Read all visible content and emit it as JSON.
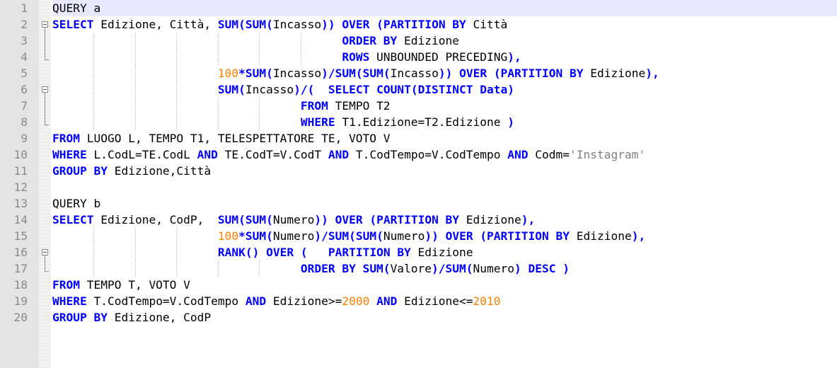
{
  "editor": {
    "line_numbers": [
      "1",
      "2",
      "3",
      "4",
      "5",
      "6",
      "7",
      "8",
      "9",
      "10",
      "11",
      "12",
      "13",
      "14",
      "15",
      "16",
      "17",
      "18",
      "19",
      "20"
    ],
    "lines": [
      [
        {
          "t": "QUERY a",
          "c": "pl"
        }
      ],
      [
        {
          "t": "SELECT",
          "c": "kw"
        },
        {
          "t": " Edizione, Città, ",
          "c": "pl"
        },
        {
          "t": "SUM(SUM(",
          "c": "kw"
        },
        {
          "t": "Incasso",
          "c": "pl"
        },
        {
          "t": "))",
          "c": "kw"
        },
        {
          "t": " ",
          "c": "pl"
        },
        {
          "t": "OVER",
          "c": "kw"
        },
        {
          "t": " ",
          "c": "pl"
        },
        {
          "t": "(PARTITION BY",
          "c": "kw"
        },
        {
          "t": " Città",
          "c": "pl"
        }
      ],
      [
        {
          "t": "                                          ",
          "c": "pl"
        },
        {
          "t": "ORDER BY",
          "c": "kw"
        },
        {
          "t": " Edizione",
          "c": "pl"
        }
      ],
      [
        {
          "t": "                                          ",
          "c": "pl"
        },
        {
          "t": "ROWS",
          "c": "kw"
        },
        {
          "t": " UNBOUNDED PRECEDING",
          "c": "pl"
        },
        {
          "t": "),",
          "c": "kw"
        }
      ],
      [
        {
          "t": "                        ",
          "c": "pl"
        },
        {
          "t": "100",
          "c": "num"
        },
        {
          "t": "*SUM(",
          "c": "kw"
        },
        {
          "t": "Incasso",
          "c": "pl"
        },
        {
          "t": ")/SUM(SUM(",
          "c": "kw"
        },
        {
          "t": "Incasso",
          "c": "pl"
        },
        {
          "t": "))",
          "c": "kw"
        },
        {
          "t": " ",
          "c": "pl"
        },
        {
          "t": "OVER",
          "c": "kw"
        },
        {
          "t": " ",
          "c": "pl"
        },
        {
          "t": "(PARTITION BY",
          "c": "kw"
        },
        {
          "t": " Edizione",
          "c": "pl"
        },
        {
          "t": "),",
          "c": "kw"
        }
      ],
      [
        {
          "t": "                        ",
          "c": "pl"
        },
        {
          "t": "SUM(",
          "c": "kw"
        },
        {
          "t": "Incasso",
          "c": "pl"
        },
        {
          "t": ")/(",
          "c": "kw"
        },
        {
          "t": "  ",
          "c": "pl"
        },
        {
          "t": "SELECT COUNT(DISTINCT",
          "c": "kw"
        },
        {
          "t": " ",
          "c": "pl"
        },
        {
          "t": "Data)",
          "c": "kw"
        }
      ],
      [
        {
          "t": "                                    ",
          "c": "pl"
        },
        {
          "t": "FROM",
          "c": "kw"
        },
        {
          "t": " TEMPO T2",
          "c": "pl"
        }
      ],
      [
        {
          "t": "                                    ",
          "c": "pl"
        },
        {
          "t": "WHERE",
          "c": "kw"
        },
        {
          "t": " T1.Edizione=T2.Edizione ",
          "c": "pl"
        },
        {
          "t": ")",
          "c": "kw"
        }
      ],
      [
        {
          "t": "FROM",
          "c": "kw"
        },
        {
          "t": " LUOGO L, TEMPO T1, TELESPETTATORE TE, VOTO V",
          "c": "pl"
        }
      ],
      [
        {
          "t": "WHERE",
          "c": "kw"
        },
        {
          "t": " L.CodL=TE.CodL ",
          "c": "pl"
        },
        {
          "t": "AND",
          "c": "kw"
        },
        {
          "t": " TE.CodT=V.CodT ",
          "c": "pl"
        },
        {
          "t": "AND",
          "c": "kw"
        },
        {
          "t": " T.CodTempo=V.CodTempo ",
          "c": "pl"
        },
        {
          "t": "AND",
          "c": "kw"
        },
        {
          "t": " Codm=",
          "c": "pl"
        },
        {
          "t": "'Instagram'",
          "c": "str"
        }
      ],
      [
        {
          "t": "GROUP BY",
          "c": "kw"
        },
        {
          "t": " Edizione,Città",
          "c": "pl"
        }
      ],
      [],
      [
        {
          "t": "QUERY b",
          "c": "pl"
        }
      ],
      [
        {
          "t": "SELECT",
          "c": "kw"
        },
        {
          "t": " Edizione, CodP,  ",
          "c": "pl"
        },
        {
          "t": "SUM(SUM(",
          "c": "kw"
        },
        {
          "t": "Numero",
          "c": "pl"
        },
        {
          "t": "))",
          "c": "kw"
        },
        {
          "t": " ",
          "c": "pl"
        },
        {
          "t": "OVER",
          "c": "kw"
        },
        {
          "t": " ",
          "c": "pl"
        },
        {
          "t": "(PARTITION BY",
          "c": "kw"
        },
        {
          "t": " Edizione",
          "c": "pl"
        },
        {
          "t": "),",
          "c": "kw"
        }
      ],
      [
        {
          "t": "                        ",
          "c": "pl"
        },
        {
          "t": "100",
          "c": "num"
        },
        {
          "t": "*SUM(",
          "c": "kw"
        },
        {
          "t": "Numero",
          "c": "pl"
        },
        {
          "t": ")/SUM(SUM(",
          "c": "kw"
        },
        {
          "t": "Numero",
          "c": "pl"
        },
        {
          "t": "))",
          "c": "kw"
        },
        {
          "t": " ",
          "c": "pl"
        },
        {
          "t": "OVER",
          "c": "kw"
        },
        {
          "t": " ",
          "c": "pl"
        },
        {
          "t": "(PARTITION BY",
          "c": "kw"
        },
        {
          "t": " Edizione",
          "c": "pl"
        },
        {
          "t": "),",
          "c": "kw"
        }
      ],
      [
        {
          "t": "                        ",
          "c": "pl"
        },
        {
          "t": "RANK() OVER (",
          "c": "kw"
        },
        {
          "t": "   ",
          "c": "pl"
        },
        {
          "t": "PARTITION BY",
          "c": "kw"
        },
        {
          "t": " Edizione",
          "c": "pl"
        }
      ],
      [
        {
          "t": "                                    ",
          "c": "pl"
        },
        {
          "t": "ORDER BY SUM(",
          "c": "kw"
        },
        {
          "t": "Valore",
          "c": "pl"
        },
        {
          "t": ")/SUM(",
          "c": "kw"
        },
        {
          "t": "Numero",
          "c": "pl"
        },
        {
          "t": ")",
          "c": "kw"
        },
        {
          "t": " ",
          "c": "pl"
        },
        {
          "t": "DESC )",
          "c": "kw"
        }
      ],
      [
        {
          "t": "FROM",
          "c": "kw"
        },
        {
          "t": " TEMPO T, VOTO V",
          "c": "pl"
        }
      ],
      [
        {
          "t": "WHERE",
          "c": "kw"
        },
        {
          "t": " T.CodTempo=V.CodTempo ",
          "c": "pl"
        },
        {
          "t": "AND",
          "c": "kw"
        },
        {
          "t": " Edizione>=",
          "c": "pl"
        },
        {
          "t": "2000",
          "c": "num"
        },
        {
          "t": " ",
          "c": "pl"
        },
        {
          "t": "AND",
          "c": "kw"
        },
        {
          "t": " Edizione<=",
          "c": "pl"
        },
        {
          "t": "2010",
          "c": "num"
        }
      ],
      [
        {
          "t": "GROUP BY",
          "c": "kw"
        },
        {
          "t": " Edizione, CodP",
          "c": "pl"
        }
      ]
    ],
    "current_line": 1
  }
}
